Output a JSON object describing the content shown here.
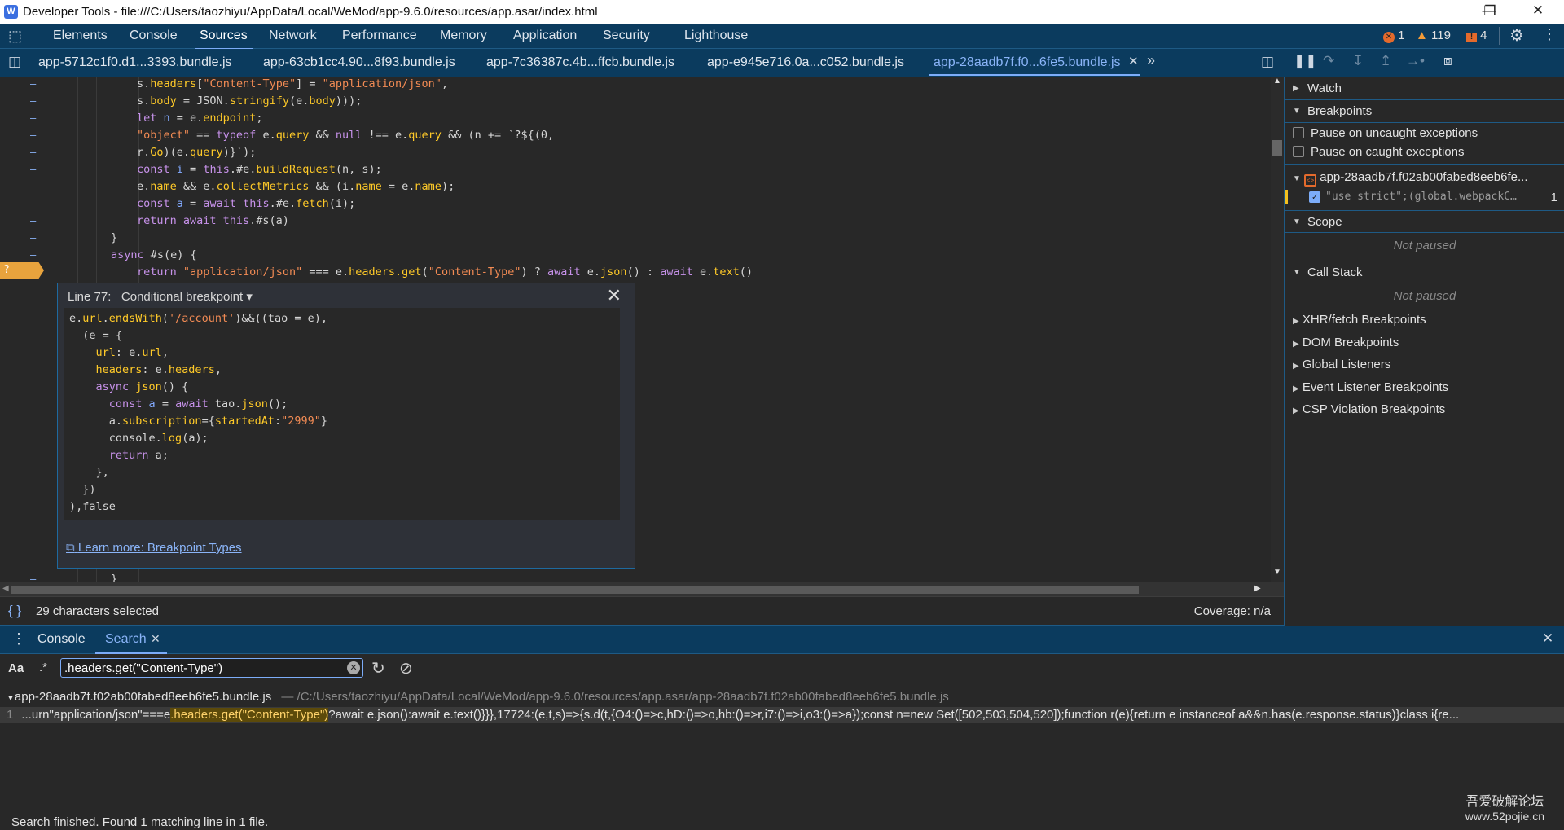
{
  "window": {
    "title": "Developer Tools - file:///C:/Users/taozhiyu/AppData/Local/WeMod/app-9.6.0/resources/app.asar/index.html",
    "controls": [
      "minimize",
      "restore",
      "close"
    ]
  },
  "main_tabs": [
    "Elements",
    "Console",
    "Sources",
    "Network",
    "Performance",
    "Memory",
    "Application",
    "Security",
    "Lighthouse"
  ],
  "active_main_tab": "Sources",
  "counts": {
    "errors": "1",
    "warnings": "119",
    "issues": "4"
  },
  "colors": {
    "accent": "#8ab4f8",
    "toolbar": "#0b3b5e",
    "breakpoint": "#e8a33d",
    "error": "#e46a2c",
    "warning": "#f29b38"
  },
  "file_tabs": [
    "app-5712c1f0.d1...3393.bundle.js",
    "app-63cb1cc4.90...8f93.bundle.js",
    "app-7c36387c.4b...ffcb.bundle.js",
    "app-e945e716.0a...c052.bundle.js",
    "app-28aadb7f.f0...6fe5.bundle.js"
  ],
  "active_file_tab": "app-28aadb7f.f0...6fe5.bundle.js",
  "code_lines": [
    {
      "indent": 6,
      "tokens": [
        [
          "w",
          "s."
        ],
        [
          "p",
          "headers"
        ],
        [
          "w",
          "["
        ],
        [
          "s",
          "\"Content-Type\""
        ],
        [
          "w",
          "] = "
        ],
        [
          "s",
          "\"application/json\""
        ],
        [
          "w",
          ","
        ]
      ]
    },
    {
      "indent": 6,
      "tokens": [
        [
          "w",
          "s."
        ],
        [
          "p",
          "body"
        ],
        [
          "w",
          " = JSON."
        ],
        [
          "p",
          "stringify"
        ],
        [
          "w",
          "(e."
        ],
        [
          "p",
          "body"
        ],
        [
          "w",
          ")));"
        ]
      ]
    },
    {
      "indent": 6,
      "tokens": [
        [
          "k",
          "let "
        ],
        [
          "v",
          "n"
        ],
        [
          "w",
          " = e."
        ],
        [
          "p",
          "endpoint"
        ],
        [
          "w",
          ";"
        ]
      ]
    },
    {
      "indent": 6,
      "tokens": [
        [
          "s",
          "\"object\""
        ],
        [
          "w",
          " == "
        ],
        [
          "k",
          "typeof "
        ],
        [
          "w",
          "e."
        ],
        [
          "p",
          "query"
        ],
        [
          "w",
          " && "
        ],
        [
          "k",
          "null"
        ],
        [
          "w",
          " !== e."
        ],
        [
          "p",
          "query"
        ],
        [
          "w",
          " && (n += `?${(0,"
        ]
      ]
    },
    {
      "indent": 6,
      "tokens": [
        [
          "w",
          "r."
        ],
        [
          "p",
          "Go"
        ],
        [
          "w",
          ")(e."
        ],
        [
          "p",
          "query"
        ],
        [
          "w",
          ")}`);"
        ]
      ]
    },
    {
      "indent": 6,
      "tokens": [
        [
          "k",
          "const "
        ],
        [
          "v",
          "i"
        ],
        [
          "w",
          " = "
        ],
        [
          "k",
          "this"
        ],
        [
          "w",
          ".#e."
        ],
        [
          "p",
          "buildRequest"
        ],
        [
          "w",
          "(n, s);"
        ]
      ]
    },
    {
      "indent": 6,
      "tokens": [
        [
          "w",
          "e."
        ],
        [
          "p",
          "name"
        ],
        [
          "w",
          " && e."
        ],
        [
          "p",
          "collectMetrics"
        ],
        [
          "w",
          " && (i."
        ],
        [
          "p",
          "name"
        ],
        [
          "w",
          " = e."
        ],
        [
          "p",
          "name"
        ],
        [
          "w",
          ");"
        ]
      ]
    },
    {
      "indent": 6,
      "tokens": [
        [
          "k",
          "const "
        ],
        [
          "v",
          "a"
        ],
        [
          "w",
          " = "
        ],
        [
          "k",
          "await this"
        ],
        [
          "w",
          ".#e."
        ],
        [
          "p",
          "fetch"
        ],
        [
          "w",
          "(i);"
        ]
      ]
    },
    {
      "indent": 6,
      "tokens": [
        [
          "k",
          "return await this"
        ],
        [
          "w",
          ".#s(a)"
        ]
      ]
    },
    {
      "indent": 4,
      "tokens": [
        [
          "w",
          "}"
        ]
      ]
    },
    {
      "indent": 4,
      "tokens": [
        [
          "k",
          "async "
        ],
        [
          "w",
          "#s(e) {"
        ]
      ]
    },
    {
      "indent": 6,
      "tokens": [
        [
          "k",
          "return "
        ],
        [
          "s",
          "\"application/json\""
        ],
        [
          "w",
          " === e."
        ],
        [
          "p",
          "headers."
        ],
        [
          "p",
          "get"
        ],
        [
          "w",
          "("
        ],
        [
          "s",
          "\"Content-Type\""
        ],
        [
          "w",
          ") ? "
        ],
        [
          "k",
          "await "
        ],
        [
          "w",
          "e."
        ],
        [
          "p",
          "json"
        ],
        [
          "w",
          "() : "
        ],
        [
          "k",
          "await "
        ],
        [
          "w",
          "e."
        ],
        [
          "p",
          "text"
        ],
        [
          "w",
          "()"
        ]
      ]
    }
  ],
  "closing_line": {
    "indent": 4,
    "tokens": [
      [
        "w",
        "}"
      ]
    ]
  },
  "breakpoint": {
    "line_label": "Line 77:",
    "type": "Conditional breakpoint",
    "gutter_marker": "?",
    "condition_lines": [
      [
        [
          "w",
          "e."
        ],
        [
          "p",
          "url"
        ],
        [
          "w",
          "."
        ],
        [
          "p",
          "endsWith"
        ],
        [
          "w",
          "("
        ],
        [
          "s",
          "'/account'"
        ],
        [
          "w",
          ")&&((tao = e),"
        ]
      ],
      [
        [
          "w",
          "  (e = {"
        ]
      ],
      [
        [
          "p",
          "    url"
        ],
        [
          "w",
          ": e."
        ],
        [
          "p",
          "url"
        ],
        [
          "w",
          ","
        ]
      ],
      [
        [
          "p",
          "    headers"
        ],
        [
          "w",
          ": e."
        ],
        [
          "p",
          "headers"
        ],
        [
          "w",
          ","
        ]
      ],
      [
        [
          "k",
          "    async "
        ],
        [
          "p",
          "json"
        ],
        [
          "w",
          "() {"
        ]
      ],
      [
        [
          "k",
          "      const "
        ],
        [
          "v",
          "a"
        ],
        [
          "w",
          " = "
        ],
        [
          "k",
          "await "
        ],
        [
          "w",
          "tao."
        ],
        [
          "p",
          "json"
        ],
        [
          "w",
          "();"
        ]
      ],
      [
        [
          "w",
          "      a."
        ],
        [
          "p",
          "subscription"
        ],
        [
          "w",
          "={"
        ],
        [
          "p",
          "startedAt"
        ],
        [
          "w",
          ":"
        ],
        [
          "s",
          "\"2999\""
        ],
        [
          "w",
          "}"
        ]
      ],
      [
        [
          "w",
          "      console."
        ],
        [
          "p",
          "log"
        ],
        [
          "w",
          "(a);"
        ]
      ],
      [
        [
          "k",
          "      return "
        ],
        [
          "w",
          "a;"
        ]
      ],
      [
        [
          "w",
          "    },"
        ]
      ],
      [
        [
          "w",
          "  })"
        ]
      ],
      [
        [
          "w",
          "),false"
        ]
      ]
    ],
    "learn_more": "Learn more: Breakpoint Types"
  },
  "status": {
    "selection": "29 characters selected",
    "coverage": "Coverage: n/a"
  },
  "debugger": {
    "watch": "Watch",
    "breakpoints": "Breakpoints",
    "pause_uncaught": "Pause on uncaught exceptions",
    "pause_caught": "Pause on caught exceptions",
    "bp_file": "app-28aadb7f.f02ab00fabed8eeb6fe...",
    "bp_entry": "\"use strict\";(global.webpackC…",
    "bp_entry_line": "1",
    "bp_entry_checked": true,
    "scope": "Scope",
    "scope_status": "Not paused",
    "call_stack": "Call Stack",
    "call_stack_status": "Not paused",
    "collapsed_sections": [
      "XHR/fetch Breakpoints",
      "DOM Breakpoints",
      "Global Listeners",
      "Event Listener Breakpoints",
      "CSP Violation Breakpoints"
    ]
  },
  "drawer": {
    "tabs": [
      "Console",
      "Search"
    ],
    "active_tab": "Search",
    "case_label": "Aa",
    "regex_label": ".*",
    "search_value": ".headers.get(\"Content-Type\")",
    "result_file": "app-28aadb7f.f02ab00fabed8eeb6fe5.bundle.js",
    "result_path": "— /C:/Users/taozhiyu/AppData/Local/WeMod/app-9.6.0/resources/app.asar/app-28aadb7f.f02ab00fabed8eeb6fe5.bundle.js",
    "result_line_no": "1",
    "result_before": "...urn\"application/json\"===e",
    "result_match": ".headers.get(\"Content-Type\")",
    "result_after": "?await e.json():await e.text()}}},17724:(e,t,s)=>{s.d(t,{O4:()=>c,hD:()=>o,hb:()=>r,i7:()=>i,o3:()=>a});const n=new Set([502,503,504,520]);function r(e){return e instanceof a&&n.has(e.response.status)}class i{re...",
    "summary": "Search finished.  Found 1 matching line in 1 file."
  },
  "watermark": {
    "line1": "吾爱破解论坛",
    "line2": "www.52pojie.cn"
  }
}
